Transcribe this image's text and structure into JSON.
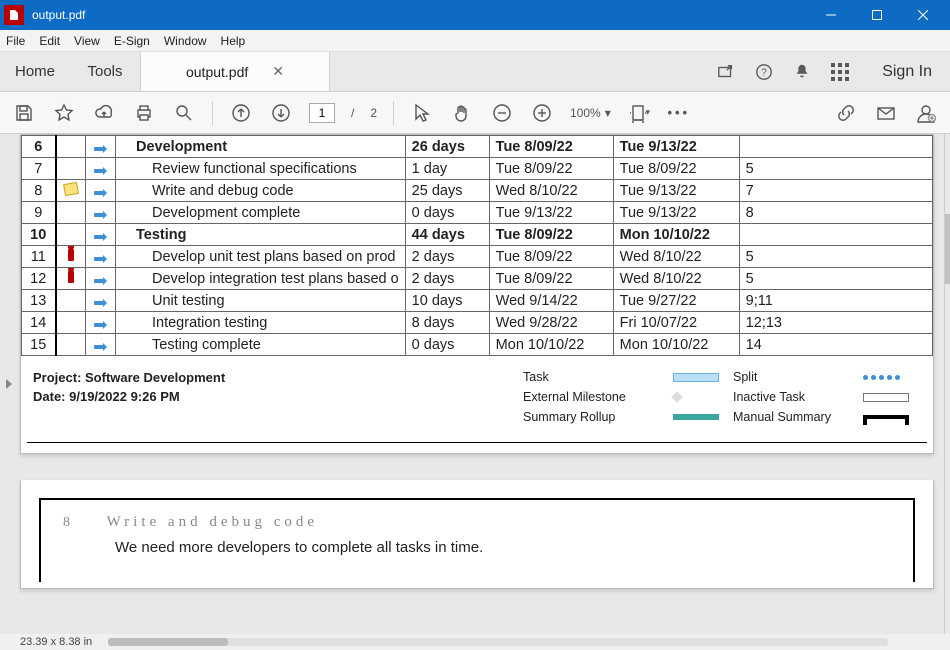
{
  "window": {
    "title": "output.pdf"
  },
  "menu": {
    "file": "File",
    "edit": "Edit",
    "view": "View",
    "esign": "E-Sign",
    "window": "Window",
    "help": "Help"
  },
  "tabs": {
    "home": "Home",
    "tools": "Tools",
    "doc": "output.pdf",
    "signin": "Sign In"
  },
  "toolbar": {
    "page_current": "1",
    "page_sep": "/",
    "page_total": "2",
    "zoom": "100%"
  },
  "table": {
    "rows": [
      {
        "idx": "6",
        "flag": "",
        "bold": true,
        "indent": 1,
        "name": "Development",
        "dur": "26 days",
        "start": "Tue 8/09/22",
        "finish": "Tue 9/13/22",
        "pred": ""
      },
      {
        "idx": "7",
        "flag": "",
        "bold": false,
        "indent": 2,
        "name": "Review functional specifications",
        "dur": "1 day",
        "start": "Tue 8/09/22",
        "finish": "Tue 8/09/22",
        "pred": "5"
      },
      {
        "idx": "8",
        "flag": "note",
        "bold": false,
        "indent": 2,
        "name": "Write and debug code",
        "dur": "25 days",
        "start": "Wed 8/10/22",
        "finish": "Tue 9/13/22",
        "pred": "7"
      },
      {
        "idx": "9",
        "flag": "",
        "bold": false,
        "indent": 2,
        "name": "Development complete",
        "dur": "0 days",
        "start": "Tue 9/13/22",
        "finish": "Tue 9/13/22",
        "pred": "8"
      },
      {
        "idx": "10",
        "flag": "",
        "bold": true,
        "indent": 1,
        "name": "Testing",
        "dur": "44 days",
        "start": "Tue 8/09/22",
        "finish": "Mon 10/10/22",
        "pred": ""
      },
      {
        "idx": "11",
        "flag": "person",
        "bold": false,
        "indent": 2,
        "name": "Develop unit test plans based on prod",
        "dur": "2 days",
        "start": "Tue 8/09/22",
        "finish": "Wed 8/10/22",
        "pred": "5"
      },
      {
        "idx": "12",
        "flag": "person",
        "bold": false,
        "indent": 2,
        "name": "Develop integration test plans based o",
        "dur": "2 days",
        "start": "Tue 8/09/22",
        "finish": "Wed 8/10/22",
        "pred": "5"
      },
      {
        "idx": "13",
        "flag": "",
        "bold": false,
        "indent": 2,
        "name": "Unit testing",
        "dur": "10 days",
        "start": "Wed 9/14/22",
        "finish": "Tue 9/27/22",
        "pred": "9;11"
      },
      {
        "idx": "14",
        "flag": "",
        "bold": false,
        "indent": 2,
        "name": "Integration testing",
        "dur": "8 days",
        "start": "Wed 9/28/22",
        "finish": "Fri 10/07/22",
        "pred": "12;13"
      },
      {
        "idx": "15",
        "flag": "",
        "bold": false,
        "indent": 2,
        "name": "Testing complete",
        "dur": "0 days",
        "start": "Mon 10/10/22",
        "finish": "Mon 10/10/22",
        "pred": "14"
      }
    ]
  },
  "legend": {
    "project_label": "Project: Software Development",
    "date_label": "Date: 9/19/2022 9:26 PM",
    "task": "Task",
    "split": "Split",
    "ext": "External Milestone",
    "inactive": "Inactive Task",
    "rollup": "Summary Rollup",
    "msum": "Manual Summary"
  },
  "page2": {
    "num": "8",
    "title": "Write and debug code",
    "body": "We need more developers to complete all tasks in time."
  },
  "status": {
    "dims": "23.39 x 8.38 in"
  }
}
